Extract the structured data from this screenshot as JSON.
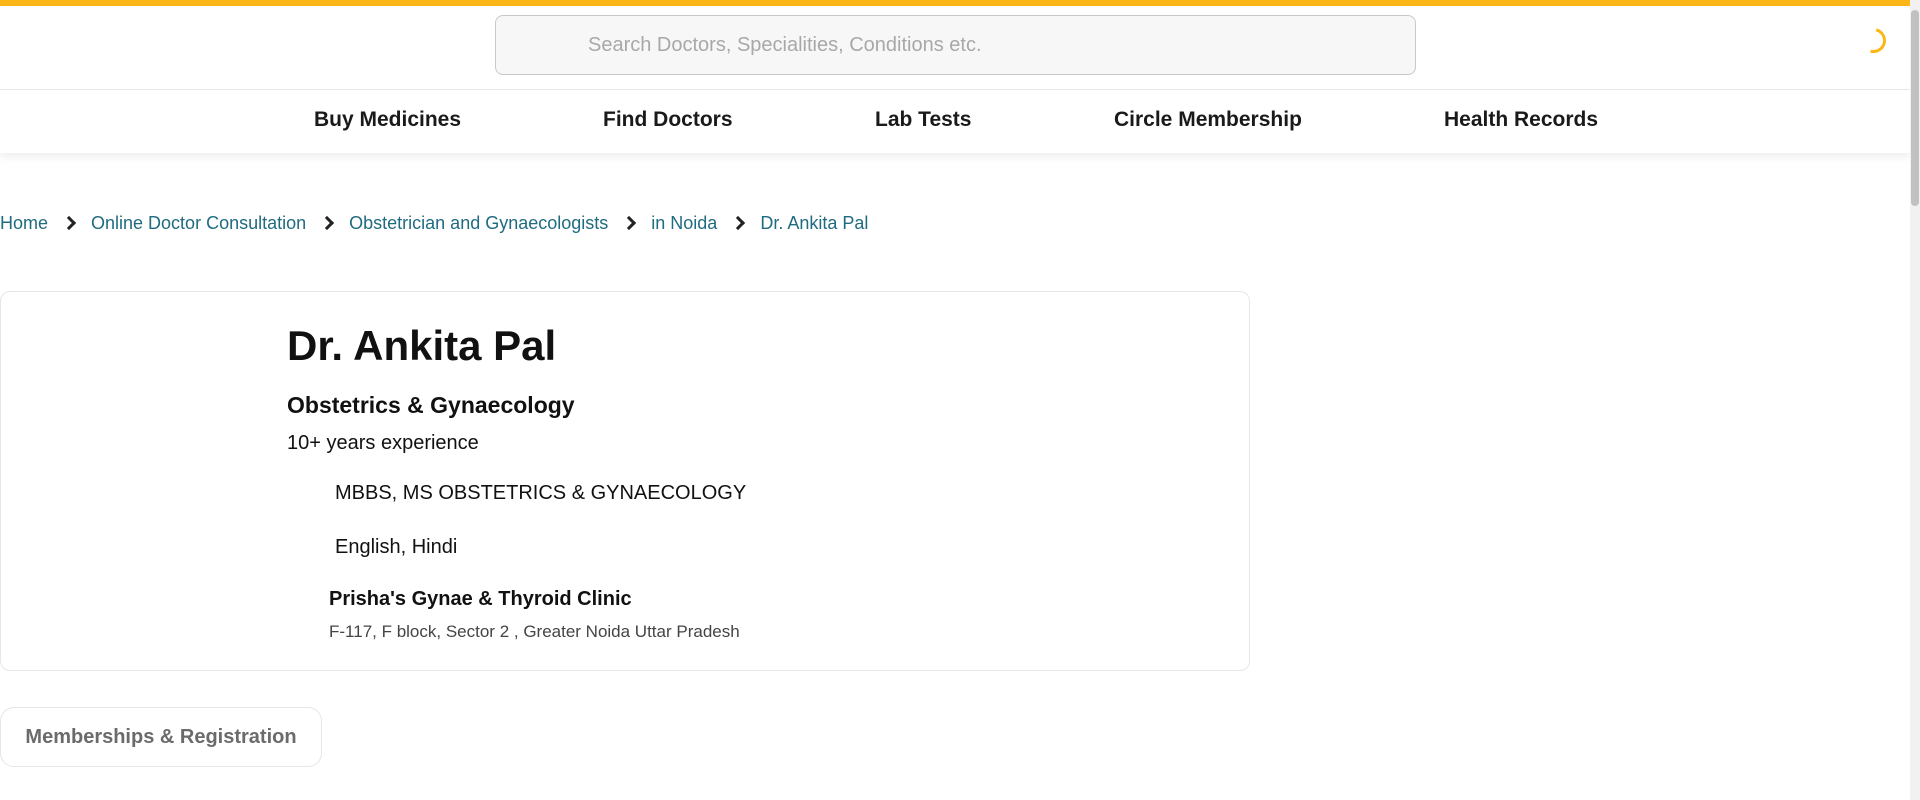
{
  "search": {
    "placeholder": "Search Doctors, Specialities, Conditions etc."
  },
  "nav": {
    "items": [
      {
        "label": "Buy Medicines"
      },
      {
        "label": "Find Doctors"
      },
      {
        "label": "Lab Tests"
      },
      {
        "label": "Circle Membership"
      },
      {
        "label": "Health Records"
      }
    ]
  },
  "breadcrumb": {
    "items": [
      {
        "label": "Home"
      },
      {
        "label": "Online Doctor Consultation"
      },
      {
        "label": "Obstetrician and Gynaecologists"
      },
      {
        "label": "in Noida"
      },
      {
        "label": "Dr. Ankita Pal"
      }
    ]
  },
  "doctor": {
    "name": "Dr. Ankita Pal",
    "speciality": "Obstetrics & Gynaecology",
    "experience": "10+ years experience",
    "degree": "MBBS, MS OBSTETRICS & GYNAECOLOGY",
    "languages": "English, Hindi",
    "clinic": {
      "name": "Prisha's Gynae & Thyroid Clinic",
      "address": "F-117, F block, Sector 2 , Greater Noida Uttar Pradesh"
    }
  },
  "tabs": {
    "memberships": "Memberships & Registration"
  },
  "colors": {
    "accent": "#fcb716",
    "link": "#1f6b80"
  },
  "icons": {
    "loading": "loading-spinner-icon",
    "separator": "chevron-right-icon"
  }
}
